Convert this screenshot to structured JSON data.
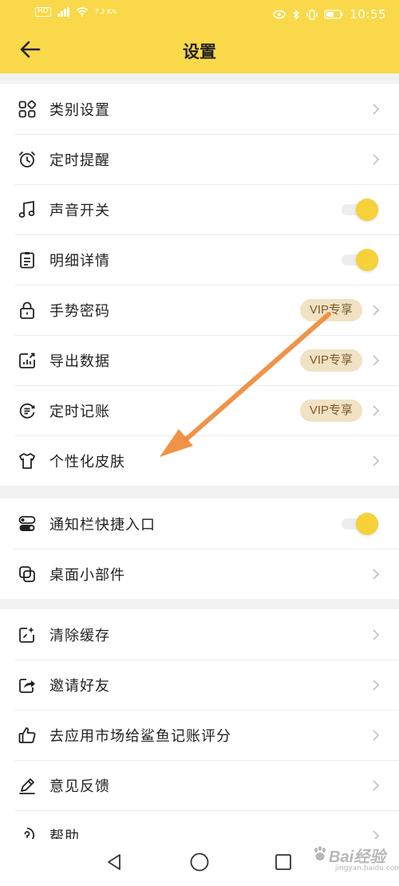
{
  "status_bar": {
    "left_chip": "HD",
    "left_small": "4G",
    "network_speed": "7.2 K/s",
    "battery": "44",
    "time": "10:55"
  },
  "header": {
    "title": "设置"
  },
  "groups": [
    {
      "items": [
        {
          "label": "类别设置",
          "icon": "category-grid-icon",
          "control": "chevron"
        },
        {
          "label": "定时提醒",
          "icon": "alarm-clock-icon",
          "control": "chevron"
        },
        {
          "label": "声音开关",
          "icon": "music-note-icon",
          "control": "toggle",
          "on": true
        },
        {
          "label": "明细详情",
          "icon": "clipboard-list-icon",
          "control": "toggle",
          "on": true
        },
        {
          "label": "手势密码",
          "icon": "lock-icon",
          "control": "vip",
          "badge": "VIP专享"
        },
        {
          "label": "导出数据",
          "icon": "export-data-icon",
          "control": "vip",
          "badge": "VIP专享"
        },
        {
          "label": "定时记账",
          "icon": "timed-bookkeeping-icon",
          "control": "vip",
          "badge": "VIP专享"
        },
        {
          "label": "个性化皮肤",
          "icon": "tshirt-icon",
          "control": "chevron"
        }
      ]
    },
    {
      "items": [
        {
          "label": "通知栏快捷入口",
          "icon": "notification-switch-icon",
          "control": "toggle",
          "on": true
        },
        {
          "label": "桌面小部件",
          "icon": "widget-icon",
          "control": "chevron"
        }
      ]
    },
    {
      "items": [
        {
          "label": "清除缓存",
          "icon": "clear-cache-icon",
          "control": "chevron"
        },
        {
          "label": "邀请好友",
          "icon": "share-icon",
          "control": "chevron"
        },
        {
          "label": "去应用市场给鲨鱼记账评分",
          "icon": "thumbs-up-icon",
          "control": "chevron"
        },
        {
          "label": "意见反馈",
          "icon": "pencil-icon",
          "control": "chevron"
        },
        {
          "label": "帮助",
          "icon": "help-icon",
          "control": "chevron"
        }
      ]
    }
  ],
  "colors": {
    "accent": "#f9d949",
    "toggle_knob": "#f6d13a",
    "vip_bg": "#f1e2c4",
    "vip_text": "#7a5a2c",
    "annotation_arrow": "#ef8a3a"
  },
  "watermark": {
    "text": "Bai经验",
    "sub": "jingyan.baidu.com"
  }
}
